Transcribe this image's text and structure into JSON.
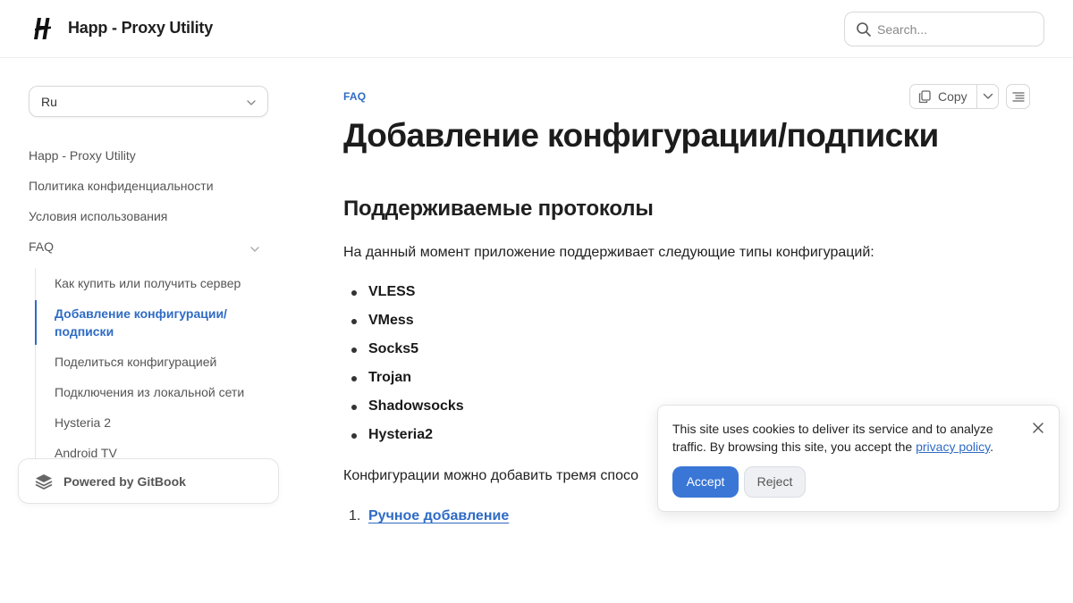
{
  "header": {
    "site_title": "Happ - Proxy Utility",
    "logo_icon": "happ-logo-icon",
    "search_placeholder": "Search..."
  },
  "sidebar": {
    "language": "Ru",
    "items": [
      {
        "label": "Happ - Proxy Utility"
      },
      {
        "label": "Политика конфиденциальности"
      },
      {
        "label": "Условия использования"
      },
      {
        "label": "FAQ"
      }
    ],
    "faq_children": [
      {
        "label": "Как купить или получить сервер"
      },
      {
        "label": "Добавление конфигурации/подписки",
        "active": true
      },
      {
        "label": "Поделиться конфигурацией"
      },
      {
        "label": "Подключения из локальной сети"
      },
      {
        "label": "Hysteria 2"
      },
      {
        "label": "Android TV"
      }
    ],
    "powered_by": "Powered by GitBook"
  },
  "main": {
    "breadcrumb": "FAQ",
    "copy_label": "Copy",
    "title": "Добавление конфигурации/подписки",
    "section_heading": "Поддерживаемые протоколы",
    "intro": "На данный момент приложение поддерживает следующие типы конфигураций:",
    "protocols": [
      "VLESS",
      "VMess",
      "Socks5",
      "Trojan",
      "Shadowsocks",
      "Hysteria2"
    ],
    "methods_intro": "Конфигурации можно добавить тремя спосо",
    "ordered_list": [
      {
        "number": "1.",
        "label": "Ручное добавление"
      }
    ]
  },
  "cookie_banner": {
    "message": "This site uses cookies to deliver its service and to analyze traffic. By browsing this site, you accept the",
    "link_text": "privacy policy",
    "after_link": ".",
    "accept_label": "Accept",
    "reject_label": "Reject"
  },
  "colors": {
    "accent": "#2f6bc4",
    "accept_button": "#3a76d6"
  }
}
